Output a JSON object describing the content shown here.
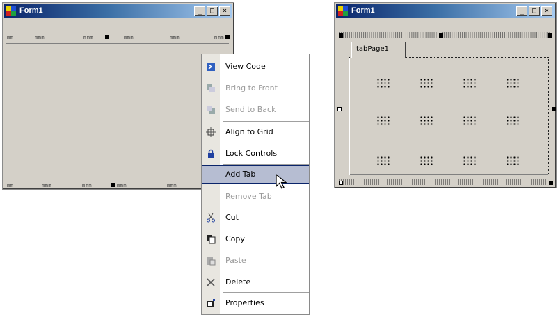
{
  "left_window": {
    "title": "Form1",
    "buttons": [
      "_",
      "□",
      "×"
    ],
    "top_ruler": [
      "mm",
      "mmm",
      "mmm",
      "mmm",
      "mmm",
      "mmm"
    ],
    "bottom_ruler": [
      "mm",
      "mmm",
      "mmm",
      "mmm",
      "mmm"
    ]
  },
  "context_menu": {
    "items": [
      {
        "label": "View Code",
        "icon": "view-code-icon",
        "disabled": false
      },
      {
        "label": "Bring to Front",
        "icon": "bring-front-icon",
        "disabled": true
      },
      {
        "label": "Send to Back",
        "icon": "send-back-icon",
        "disabled": true
      },
      {
        "label": "Align to Grid",
        "icon": "align-grid-icon",
        "disabled": false
      },
      {
        "label": "Lock Controls",
        "icon": "lock-icon",
        "disabled": false
      },
      {
        "label": "Add Tab",
        "icon": "",
        "disabled": false,
        "highlighted": true
      },
      {
        "label": "Remove Tab",
        "icon": "",
        "disabled": true
      },
      {
        "label": "Cut",
        "icon": "cut-icon",
        "disabled": false
      },
      {
        "label": "Copy",
        "icon": "copy-icon",
        "disabled": false
      },
      {
        "label": "Paste",
        "icon": "paste-icon",
        "disabled": true
      },
      {
        "label": "Delete",
        "icon": "delete-icon",
        "disabled": false
      },
      {
        "label": "Properties",
        "icon": "properties-icon",
        "disabled": false
      }
    ]
  },
  "right_window": {
    "title": "Form1",
    "buttons": [
      "_",
      "□",
      "×"
    ],
    "tab_label": "tabPage1"
  }
}
